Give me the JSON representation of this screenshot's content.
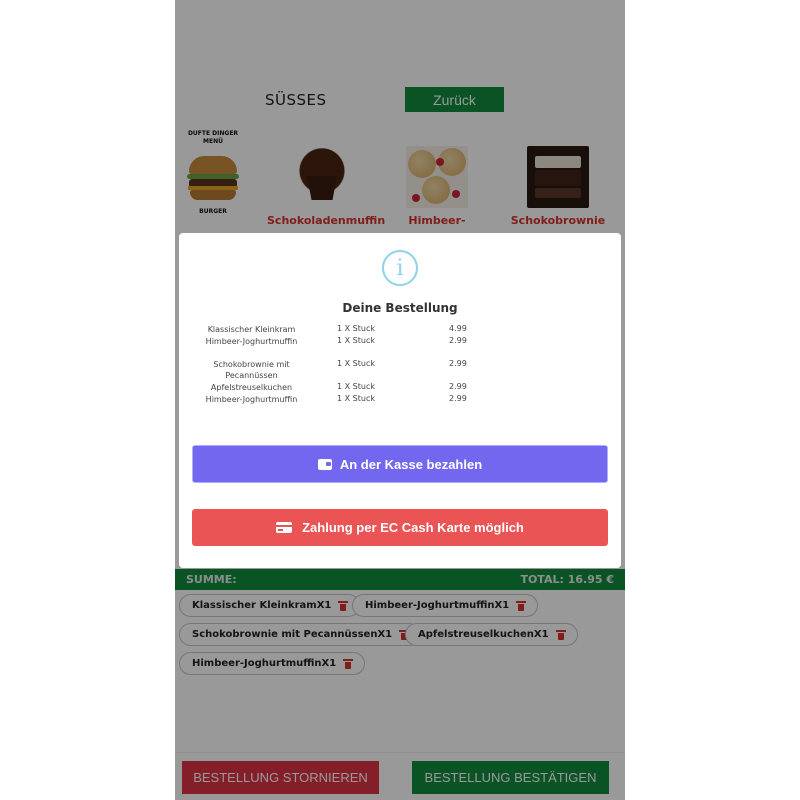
{
  "header": {
    "category_title": "SÜSSES",
    "back_label": "Zurück"
  },
  "products": [
    {
      "name": "Schokoladenmuffin",
      "image": "chocolate-muffin"
    },
    {
      "name": "Himbeer-",
      "image": "raspberry-muffin"
    },
    {
      "name": "Schokobrownie",
      "image": "brownie"
    }
  ],
  "burger_card": {
    "title_line1": "DUFTE DINGER",
    "title_line2": "MENÜ",
    "label": "BURGER"
  },
  "modal": {
    "icon": "info-icon",
    "title": "Deine Bestellung",
    "items": [
      {
        "name": "Klassischer Kleinkram",
        "qty": "1 X Stuck",
        "price": "4.99"
      },
      {
        "name": "Himbeer-Joghurtmuffin",
        "qty": "1 X Stuck",
        "price": "2.99"
      },
      {
        "name": "Schokobrownie mit Pecannüssen",
        "qty": "1 X Stuck",
        "price": "2.99"
      },
      {
        "name": "Apfelstreuselkuchen",
        "qty": "1 X Stuck",
        "price": "2.99"
      },
      {
        "name": "Himbeer-Joghurtmuffin",
        "qty": "1 X Stuck",
        "price": "2.99"
      }
    ],
    "pay_cash_label": "An der Kasse bezahlen",
    "pay_card_label": "Zahlung per EC Cash Karte möglich"
  },
  "summary": {
    "label": "SUMME:",
    "total": "TOTAL: 16.95 €"
  },
  "cart_chips": [
    {
      "label": "Klassischer KleinkramX1"
    },
    {
      "label": "Himbeer-JoghurtmuffinX1"
    },
    {
      "label": "Schokobrownie mit PecannüssenX1"
    },
    {
      "label": "ApfelstreuselkuchenX1"
    },
    {
      "label": "Himbeer-JoghurtmuffinX1"
    }
  ],
  "footer": {
    "cancel_label": "BESTELLUNG STORNIEREN",
    "confirm_label": "BESTELLUNG BESTÄTIGEN"
  },
  "colors": {
    "brand_green": "#118a3e",
    "danger_red": "#dc3545",
    "product_name_red": "#d6322b",
    "pay_purple": "#7367f0",
    "card_red": "#ea5455",
    "info_blue": "#8ed3ea"
  }
}
